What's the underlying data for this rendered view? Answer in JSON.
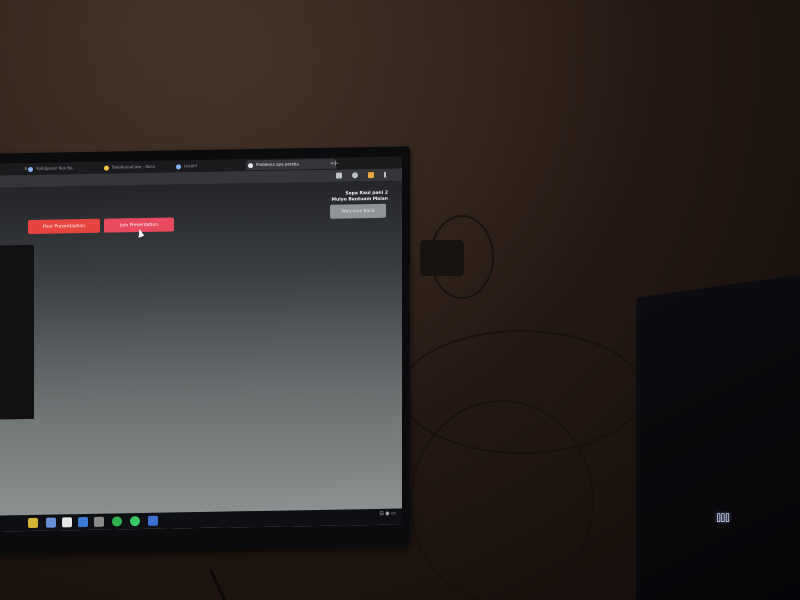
{
  "browser": {
    "tabs": [
      {
        "label": "",
        "active": false
      },
      {
        "label": "Solidparan Rev Ba",
        "active": false
      },
      {
        "label": "BalaKamaCata - Rasa",
        "active": false
      },
      {
        "label": "Localif",
        "active": false
      },
      {
        "label": "Problema apa pereba",
        "active": true
      }
    ],
    "new_tab_symbol": "+"
  },
  "page": {
    "user_line_1": "Sepa Raul pani 2",
    "user_line_2": "Mulyo Bentuam Maian",
    "buttons": {
      "left": "Pour Presentastion",
      "middle": "Join Presentation",
      "right": "Welcome Back"
    }
  },
  "taskbar": {
    "tray_text": "⊡ ◉ ▭"
  },
  "device": {
    "led_text": "⌷⌷⌷"
  },
  "colors": {
    "accent_red": "#e6443f",
    "accent_pink": "#e84a5f",
    "screen_bg": "#6c7172"
  },
  "icons": [
    "chrome-tab-favicon",
    "close-icon",
    "new-tab-icon",
    "mouse-cursor-icon",
    "taskbar-app-icon"
  ]
}
